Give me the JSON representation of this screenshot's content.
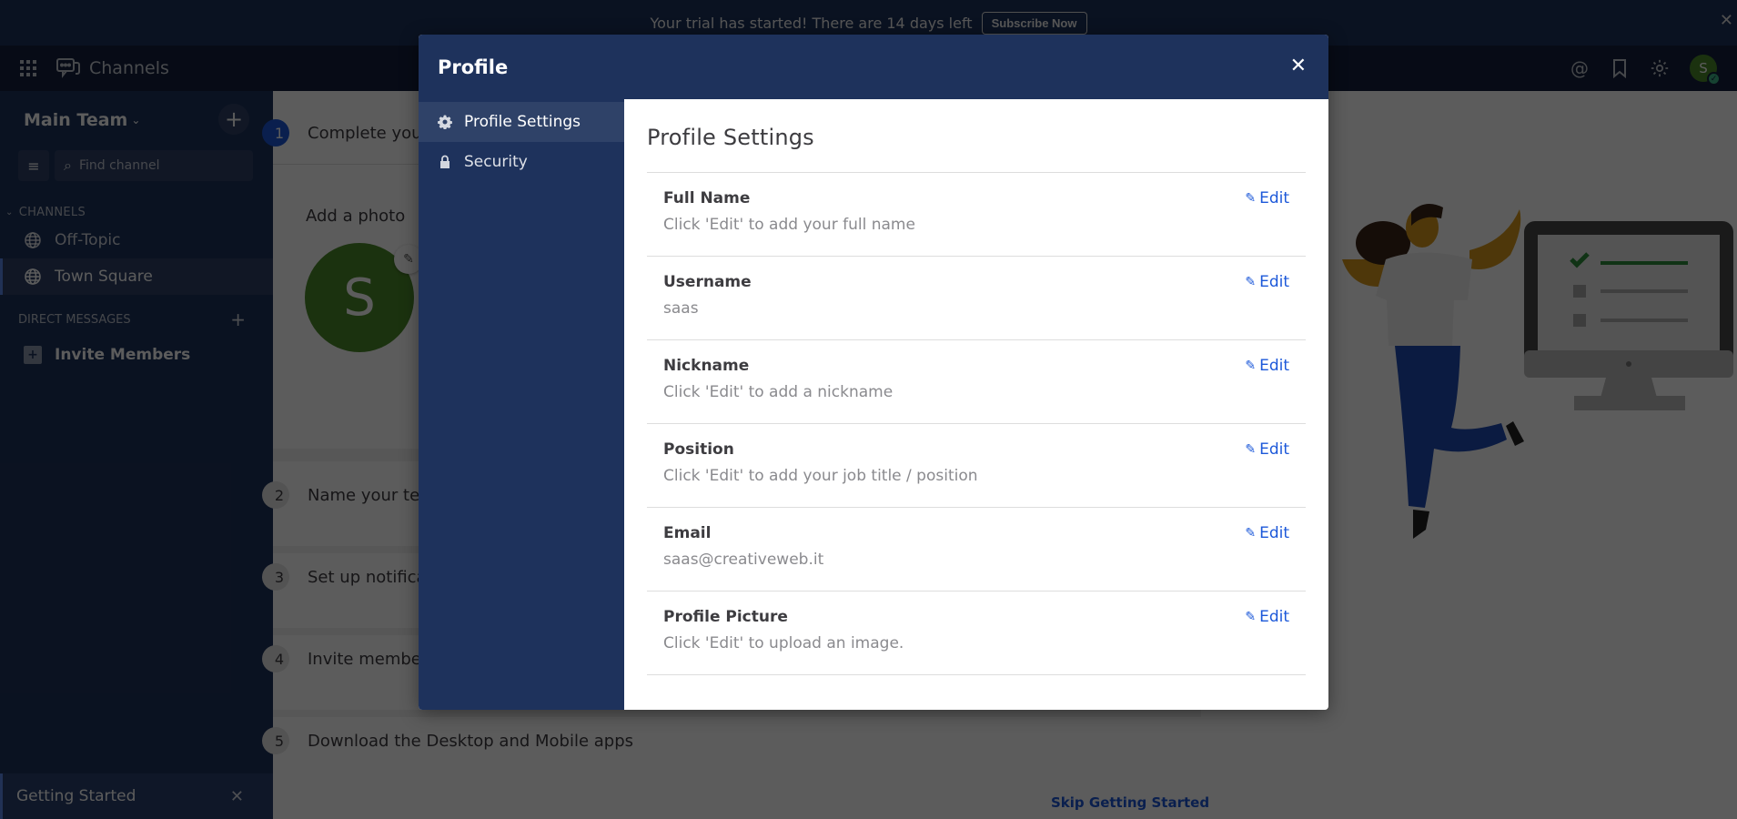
{
  "banner": {
    "message": "Your trial has started! There are 14 days left",
    "subscribe_label": "Subscribe Now",
    "close_icon": "close-icon"
  },
  "header": {
    "product_icon": "grid-icon",
    "app_icon": "channels-icon",
    "app_title": "Channels",
    "right_icons": [
      "at-mention-icon",
      "bookmark-icon",
      "gear-icon"
    ],
    "avatar_initial": "S"
  },
  "sidebar": {
    "team_name": "Main Team",
    "find_placeholder": "Find channel",
    "channels_header": "CHANNELS",
    "channels": [
      {
        "label": "Off-Topic",
        "icon": "globe-icon",
        "active": false
      },
      {
        "label": "Town Square",
        "icon": "globe-icon",
        "active": true
      }
    ],
    "dm_header": "DIRECT MESSAGES",
    "invite_label": "Invite Members",
    "getting_started_label": "Getting Started"
  },
  "main": {
    "tasks": [
      {
        "num": "1",
        "label": "Complete your profile",
        "active": true
      },
      {
        "num": "2",
        "label": "Name your team",
        "active": false
      },
      {
        "num": "3",
        "label": "Set up notifications",
        "active": false
      },
      {
        "num": "4",
        "label": "Invite members",
        "active": false
      },
      {
        "num": "5",
        "label": "Download the Desktop and Mobile apps",
        "active": false
      }
    ],
    "add_photo_label": "Add a photo",
    "avatar_initial": "S",
    "skip_label": "Skip Getting Started"
  },
  "modal": {
    "title": "Profile",
    "nav": [
      {
        "label": "Profile Settings",
        "icon": "gear-icon",
        "active": true
      },
      {
        "label": "Security",
        "icon": "lock-icon",
        "active": false
      }
    ],
    "content_title": "Profile Settings",
    "edit_label": "Edit",
    "settings": [
      {
        "label": "Full Name",
        "value": "Click 'Edit' to add your full name"
      },
      {
        "label": "Username",
        "value": "saas"
      },
      {
        "label": "Nickname",
        "value": "Click 'Edit' to add a nickname"
      },
      {
        "label": "Position",
        "value": "Click 'Edit' to add your job title / position"
      },
      {
        "label": "Email",
        "value": "saas@creativeweb.it"
      },
      {
        "label": "Profile Picture",
        "value": "Click 'Edit' to upload an image."
      }
    ]
  },
  "colors": {
    "brand_navy": "#1e325c",
    "link_blue": "#1c58d9",
    "avatar_green": "#4d8a2a"
  }
}
